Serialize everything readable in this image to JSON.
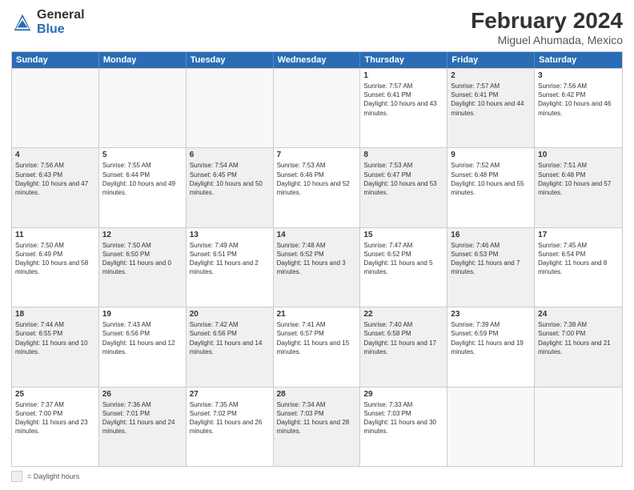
{
  "logo": {
    "general": "General",
    "blue": "Blue"
  },
  "title": "February 2024",
  "subtitle": "Miguel Ahumada, Mexico",
  "weekdays": [
    "Sunday",
    "Monday",
    "Tuesday",
    "Wednesday",
    "Thursday",
    "Friday",
    "Saturday"
  ],
  "weeks": [
    [
      {
        "day": "",
        "info": "",
        "shaded": false,
        "empty": true
      },
      {
        "day": "",
        "info": "",
        "shaded": false,
        "empty": true
      },
      {
        "day": "",
        "info": "",
        "shaded": false,
        "empty": true
      },
      {
        "day": "",
        "info": "",
        "shaded": false,
        "empty": true
      },
      {
        "day": "1",
        "info": "Sunrise: 7:57 AM\nSunset: 6:41 PM\nDaylight: 10 hours and 43 minutes.",
        "shaded": false,
        "empty": false
      },
      {
        "day": "2",
        "info": "Sunrise: 7:57 AM\nSunset: 6:41 PM\nDaylight: 10 hours and 44 minutes.",
        "shaded": true,
        "empty": false
      },
      {
        "day": "3",
        "info": "Sunrise: 7:56 AM\nSunset: 6:42 PM\nDaylight: 10 hours and 46 minutes.",
        "shaded": false,
        "empty": false
      }
    ],
    [
      {
        "day": "4",
        "info": "Sunrise: 7:56 AM\nSunset: 6:43 PM\nDaylight: 10 hours and 47 minutes.",
        "shaded": true,
        "empty": false
      },
      {
        "day": "5",
        "info": "Sunrise: 7:55 AM\nSunset: 6:44 PM\nDaylight: 10 hours and 49 minutes.",
        "shaded": false,
        "empty": false
      },
      {
        "day": "6",
        "info": "Sunrise: 7:54 AM\nSunset: 6:45 PM\nDaylight: 10 hours and 50 minutes.",
        "shaded": true,
        "empty": false
      },
      {
        "day": "7",
        "info": "Sunrise: 7:53 AM\nSunset: 6:46 PM\nDaylight: 10 hours and 52 minutes.",
        "shaded": false,
        "empty": false
      },
      {
        "day": "8",
        "info": "Sunrise: 7:53 AM\nSunset: 6:47 PM\nDaylight: 10 hours and 53 minutes.",
        "shaded": true,
        "empty": false
      },
      {
        "day": "9",
        "info": "Sunrise: 7:52 AM\nSunset: 6:48 PM\nDaylight: 10 hours and 55 minutes.",
        "shaded": false,
        "empty": false
      },
      {
        "day": "10",
        "info": "Sunrise: 7:51 AM\nSunset: 6:48 PM\nDaylight: 10 hours and 57 minutes.",
        "shaded": true,
        "empty": false
      }
    ],
    [
      {
        "day": "11",
        "info": "Sunrise: 7:50 AM\nSunset: 6:49 PM\nDaylight: 10 hours and 58 minutes.",
        "shaded": false,
        "empty": false
      },
      {
        "day": "12",
        "info": "Sunrise: 7:50 AM\nSunset: 6:50 PM\nDaylight: 11 hours and 0 minutes.",
        "shaded": true,
        "empty": false
      },
      {
        "day": "13",
        "info": "Sunrise: 7:49 AM\nSunset: 6:51 PM\nDaylight: 11 hours and 2 minutes.",
        "shaded": false,
        "empty": false
      },
      {
        "day": "14",
        "info": "Sunrise: 7:48 AM\nSunset: 6:52 PM\nDaylight: 11 hours and 3 minutes.",
        "shaded": true,
        "empty": false
      },
      {
        "day": "15",
        "info": "Sunrise: 7:47 AM\nSunset: 6:52 PM\nDaylight: 11 hours and 5 minutes.",
        "shaded": false,
        "empty": false
      },
      {
        "day": "16",
        "info": "Sunrise: 7:46 AM\nSunset: 6:53 PM\nDaylight: 11 hours and 7 minutes.",
        "shaded": true,
        "empty": false
      },
      {
        "day": "17",
        "info": "Sunrise: 7:45 AM\nSunset: 6:54 PM\nDaylight: 11 hours and 8 minutes.",
        "shaded": false,
        "empty": false
      }
    ],
    [
      {
        "day": "18",
        "info": "Sunrise: 7:44 AM\nSunset: 6:55 PM\nDaylight: 11 hours and 10 minutes.",
        "shaded": true,
        "empty": false
      },
      {
        "day": "19",
        "info": "Sunrise: 7:43 AM\nSunset: 6:56 PM\nDaylight: 11 hours and 12 minutes.",
        "shaded": false,
        "empty": false
      },
      {
        "day": "20",
        "info": "Sunrise: 7:42 AM\nSunset: 6:56 PM\nDaylight: 11 hours and 14 minutes.",
        "shaded": true,
        "empty": false
      },
      {
        "day": "21",
        "info": "Sunrise: 7:41 AM\nSunset: 6:57 PM\nDaylight: 11 hours and 15 minutes.",
        "shaded": false,
        "empty": false
      },
      {
        "day": "22",
        "info": "Sunrise: 7:40 AM\nSunset: 6:58 PM\nDaylight: 11 hours and 17 minutes.",
        "shaded": true,
        "empty": false
      },
      {
        "day": "23",
        "info": "Sunrise: 7:39 AM\nSunset: 6:59 PM\nDaylight: 11 hours and 19 minutes.",
        "shaded": false,
        "empty": false
      },
      {
        "day": "24",
        "info": "Sunrise: 7:38 AM\nSunset: 7:00 PM\nDaylight: 11 hours and 21 minutes.",
        "shaded": true,
        "empty": false
      }
    ],
    [
      {
        "day": "25",
        "info": "Sunrise: 7:37 AM\nSunset: 7:00 PM\nDaylight: 11 hours and 23 minutes.",
        "shaded": false,
        "empty": false
      },
      {
        "day": "26",
        "info": "Sunrise: 7:36 AM\nSunset: 7:01 PM\nDaylight: 11 hours and 24 minutes.",
        "shaded": true,
        "empty": false
      },
      {
        "day": "27",
        "info": "Sunrise: 7:35 AM\nSunset: 7:02 PM\nDaylight: 11 hours and 26 minutes.",
        "shaded": false,
        "empty": false
      },
      {
        "day": "28",
        "info": "Sunrise: 7:34 AM\nSunset: 7:03 PM\nDaylight: 11 hours and 28 minutes.",
        "shaded": true,
        "empty": false
      },
      {
        "day": "29",
        "info": "Sunrise: 7:33 AM\nSunset: 7:03 PM\nDaylight: 11 hours and 30 minutes.",
        "shaded": false,
        "empty": false
      },
      {
        "day": "",
        "info": "",
        "shaded": false,
        "empty": true
      },
      {
        "day": "",
        "info": "",
        "shaded": false,
        "empty": true
      }
    ]
  ],
  "legend": {
    "box_label": "= Daylight hours"
  }
}
